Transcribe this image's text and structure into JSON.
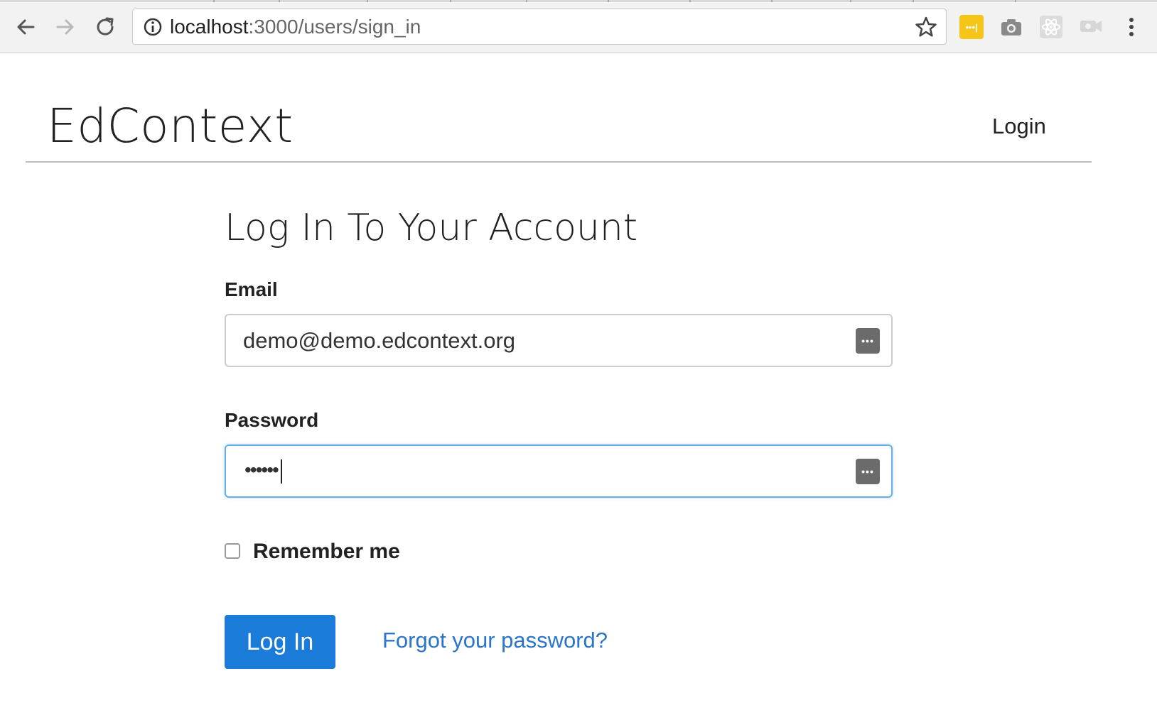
{
  "browser": {
    "url_host": "localhost",
    "url_rest": ":3000/users/sign_in",
    "icons": {
      "back": "back-arrow-icon",
      "forward": "forward-arrow-icon",
      "reload": "reload-icon",
      "info": "info-icon",
      "bookmark": "star-icon",
      "extensions": [
        "lastpass-icon",
        "camera-icon",
        "react-icon",
        "cast-icon"
      ],
      "menu": "menu-dots-icon"
    },
    "lastpass_badge": "•••|"
  },
  "header": {
    "brand": "EdContext",
    "nav_login": "Login"
  },
  "form": {
    "title": "Log In To Your Account",
    "email_label": "Email",
    "email_value": "demo@demo.edcontext.org",
    "password_label": "Password",
    "password_mask": "••••••",
    "password_field_icon": "•••",
    "remember_label": "Remember me",
    "remember_checked": false,
    "submit_label": "Log In",
    "forgot_link": "Forgot your password?"
  },
  "colors": {
    "primary": "#1a7bd8",
    "link": "#2a74c9",
    "focus_border": "#66afe9",
    "lastpass_yellow": "#f5c518"
  }
}
